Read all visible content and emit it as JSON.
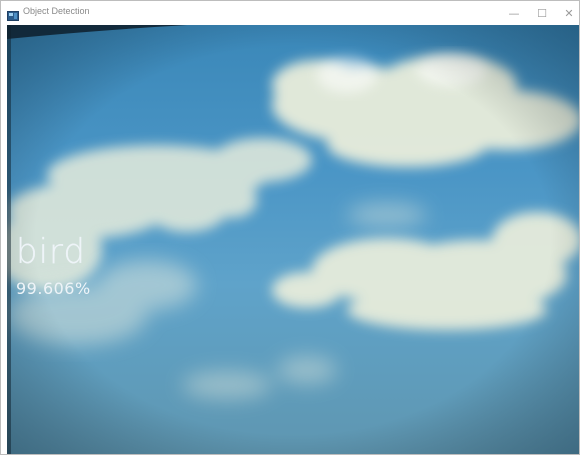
{
  "window": {
    "title": "Object Detection",
    "controls": {
      "minimize": "—",
      "maximize": "☐",
      "close": "✕"
    }
  },
  "detection": {
    "label": "bird",
    "confidence": "99.606%"
  },
  "colors": {
    "sky_top": "#3a87b8",
    "sky_bottom": "#5f96b0",
    "overlay_text": "#eef4f8",
    "cloud": "#e8eee0"
  },
  "icons": {
    "app": "app-window-icon"
  }
}
